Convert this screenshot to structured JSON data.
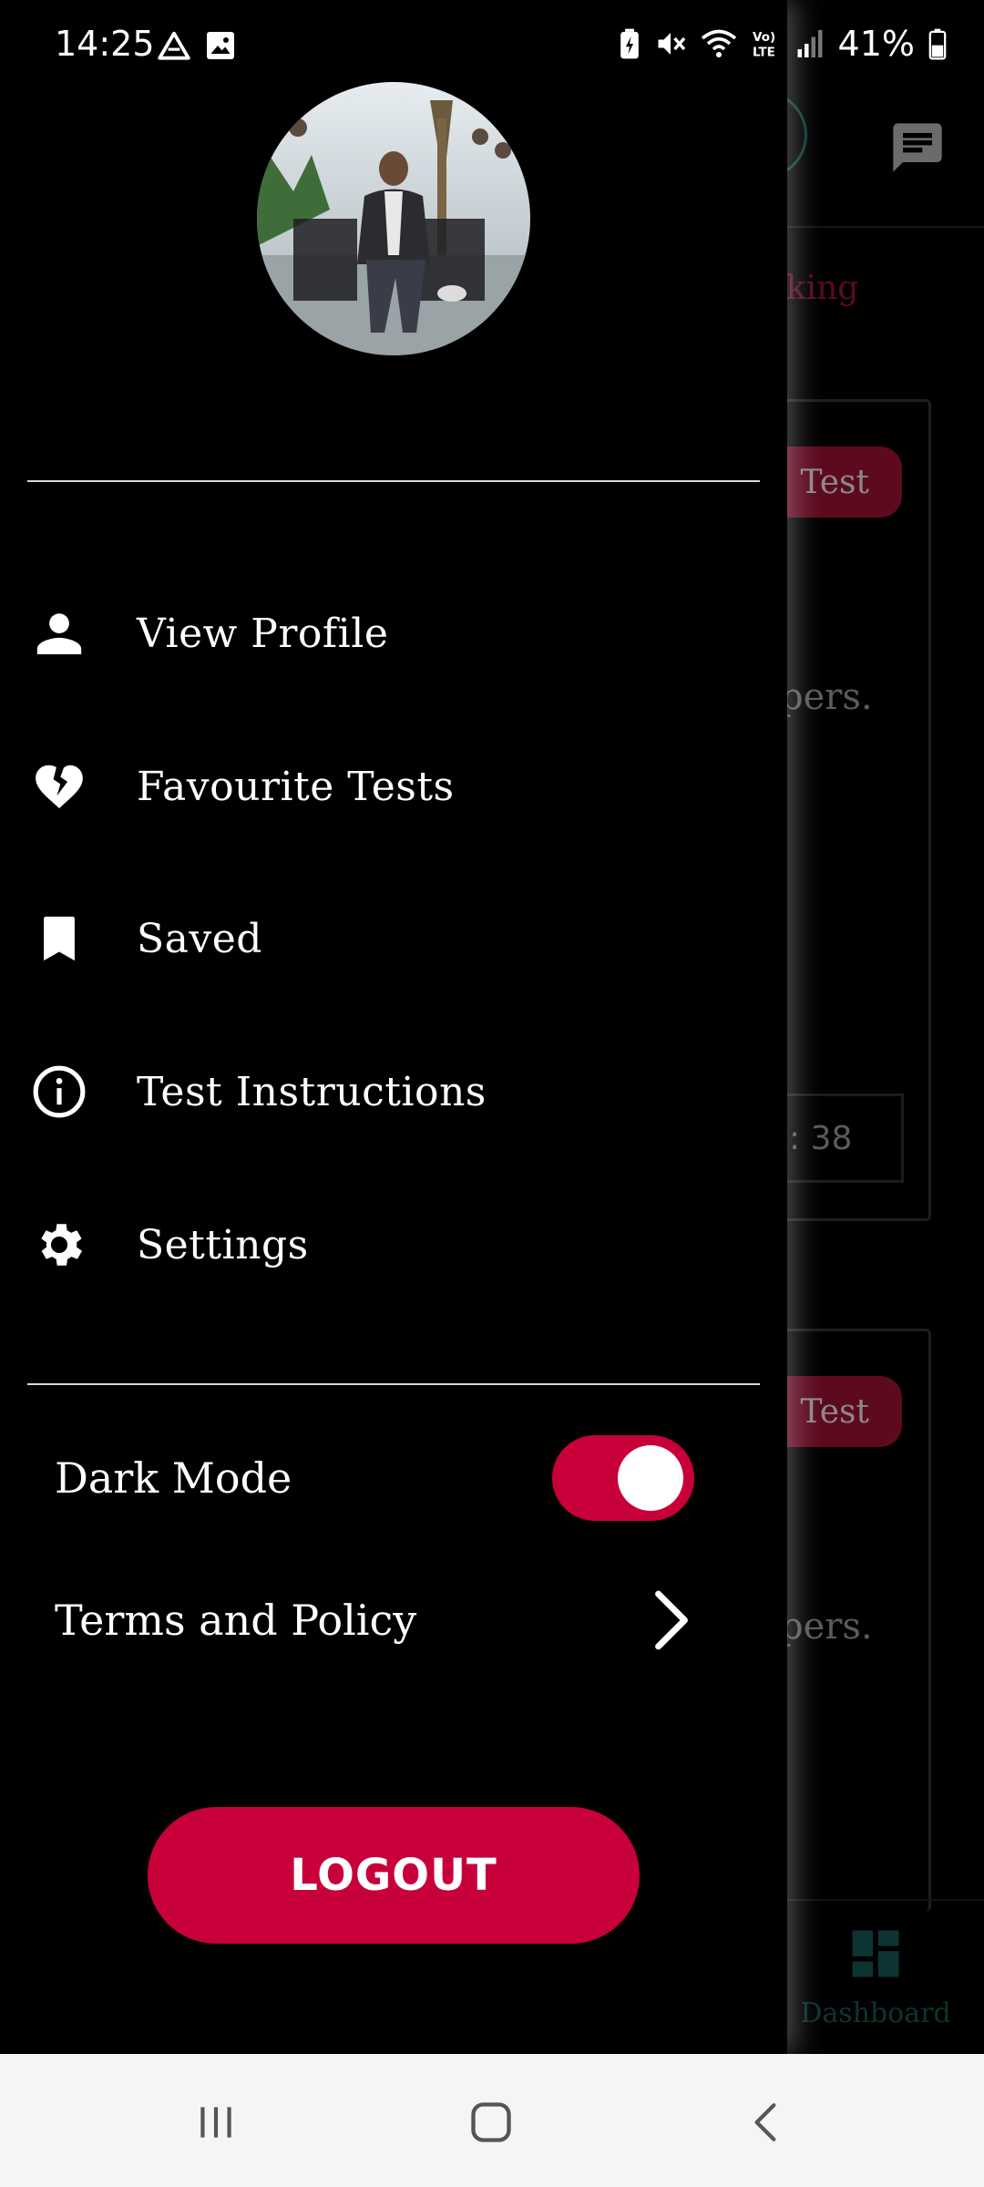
{
  "status_bar": {
    "time": "14:25",
    "battery_percent": "41%",
    "icons": [
      "drive-icon",
      "image-icon",
      "battery-saver-icon",
      "mute-icon",
      "wifi-icon",
      "volte-icon",
      "signal-icon",
      "battery-icon"
    ]
  },
  "drawer": {
    "menu": [
      {
        "label": "View Profile",
        "icon": "person-icon"
      },
      {
        "label": "Favourite Tests",
        "icon": "broken-heart-icon"
      },
      {
        "label": "Saved",
        "icon": "bookmark-icon"
      },
      {
        "label": "Test Instructions",
        "icon": "info-icon"
      },
      {
        "label": "Settings",
        "icon": "gear-icon"
      }
    ],
    "dark_mode": {
      "label": "Dark Mode",
      "enabled": true
    },
    "terms": {
      "label": "Terms and Policy"
    },
    "logout_label": "LOGOUT"
  },
  "background": {
    "tab_fragment": "eaking",
    "card1": {
      "pill": "Test",
      "text": "pers.",
      "timer": ": 38"
    },
    "card2": {
      "pill": "Test",
      "text": "pers."
    },
    "nav_label": "Dashboard"
  },
  "colors": {
    "accent": "#c8003a",
    "drawer_bg": "#000000",
    "nav_bar_bg": "#f5f5f7"
  }
}
